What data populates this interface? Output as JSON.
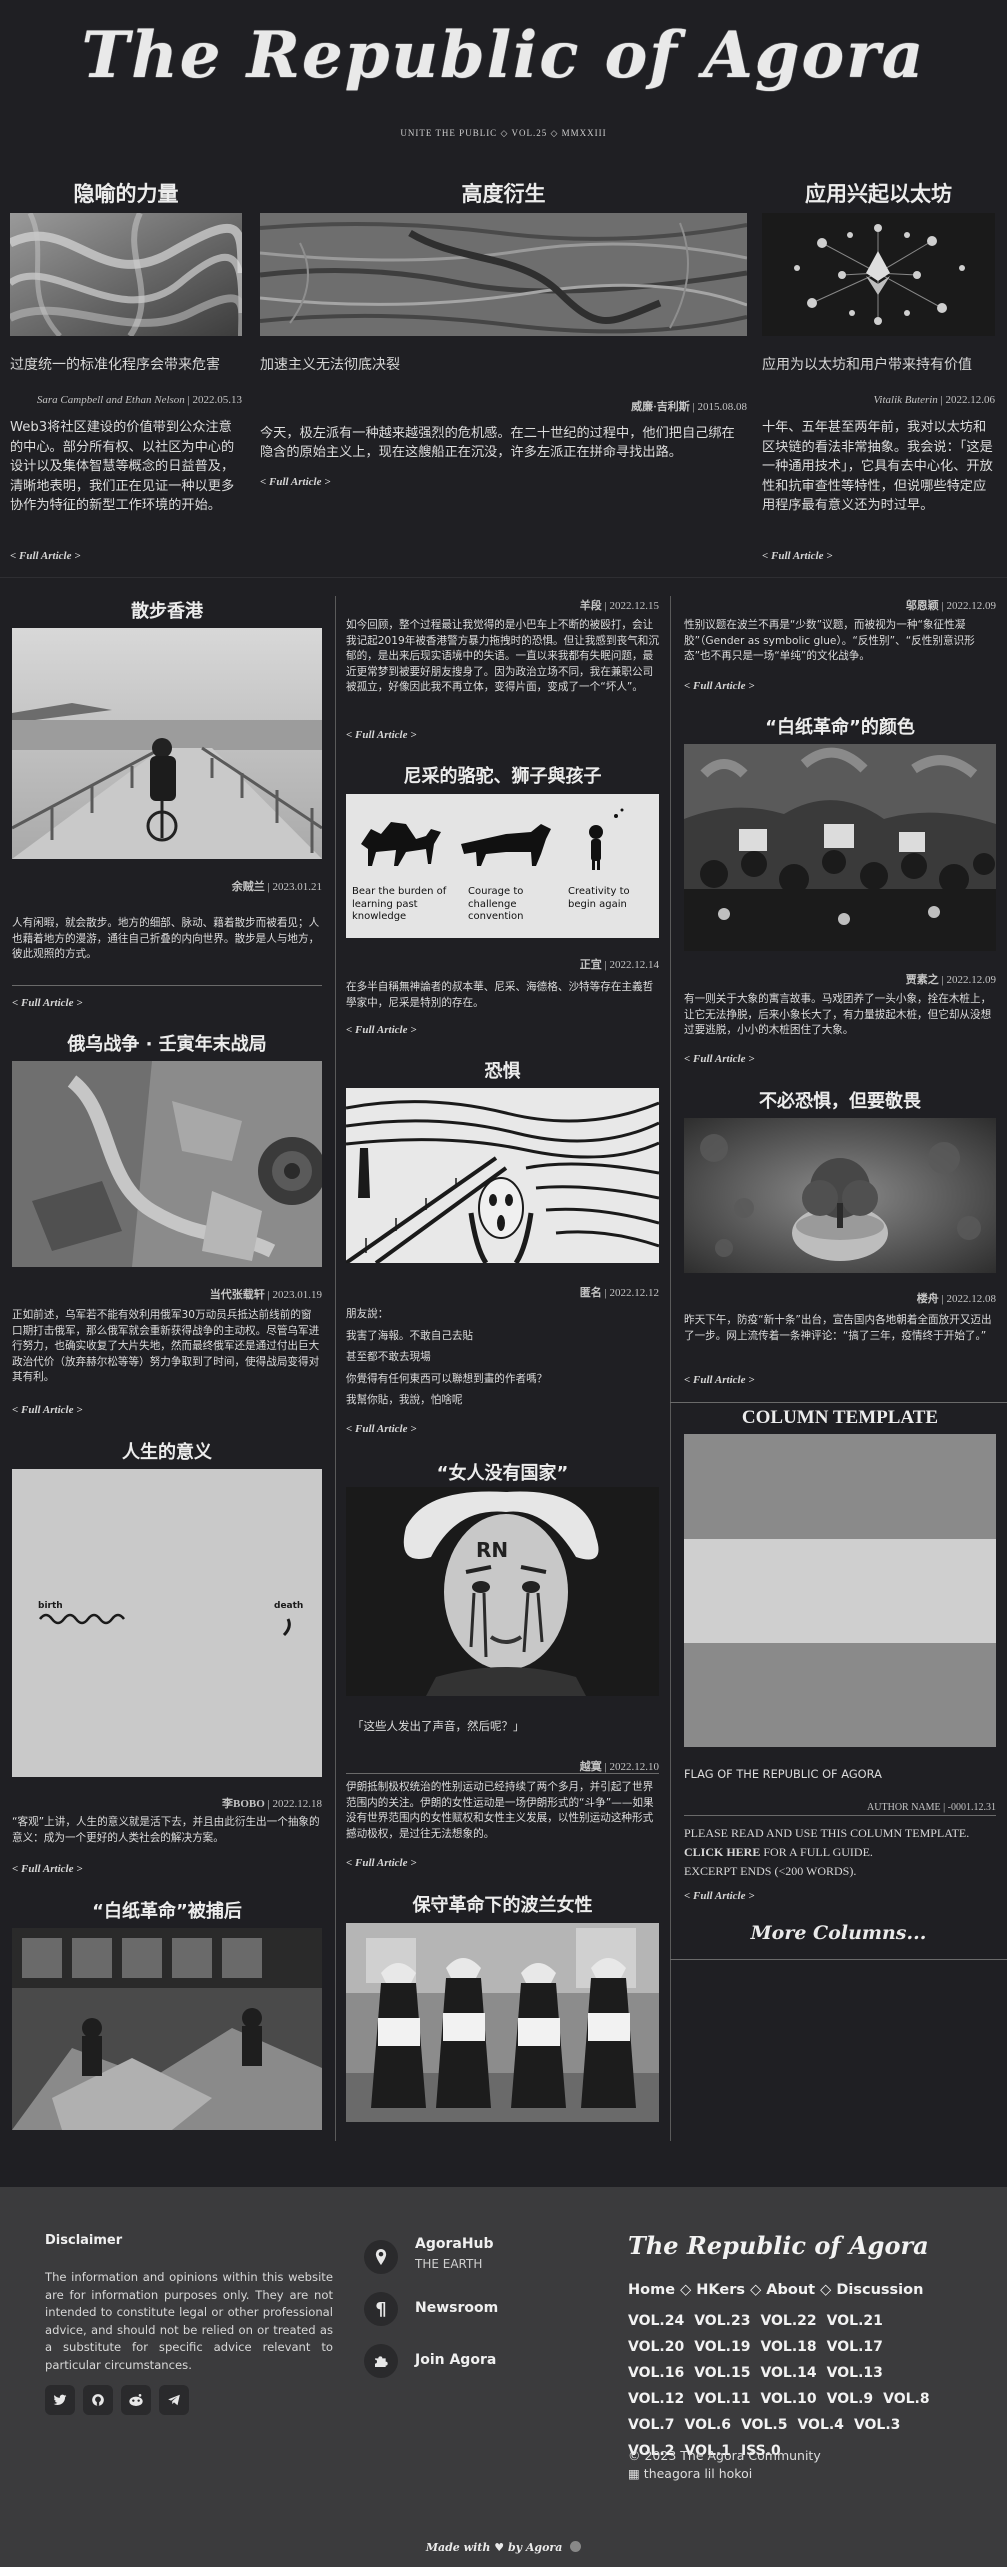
{
  "site": {
    "title": "The Republic of Agora",
    "subtitle": "UNITE THE PUBLIC ◇ VOL.25 ◇ MMXXIII"
  },
  "top": [
    {
      "heading": "隐喻的力量",
      "lead": "过度统一的标准化程序会带来危害",
      "byline_author": "Sara Campbell and Ethan Nelson",
      "byline_date": "| 2022.05.13",
      "body": "Web3将社区建设的价值带到公众注意的中心。部分所有权、以社区为中心的设计以及集体智慧等概念的日益普及，清晰地表明，我们正在见证一种以更多协作为特征的新型工作环境的开始。",
      "full": "< Full Article >",
      "image": "swirl-texture-image"
    },
    {
      "heading": "高度衍生",
      "lead": "加速主义无法彻底决裂",
      "byline_author": "威廉·吉利斯",
      "byline_date": "| 2015.08.08",
      "body": "今天，极左派有一种越来越强烈的危机感。在二十世纪的过程中，他们把自己绑在隐含的原始主义上，现在这艘船正在沉没，许多左派正在拼命寻找出路。",
      "full": "< Full Article >",
      "image": "bark-texture-image"
    },
    {
      "heading": "应用兴起以太坊",
      "lead": "应用为以太坊和用户带来持有价值",
      "byline_author": "Vitalik Buterin",
      "byline_date": "| 2022.12.06",
      "body": "十年、五年甚至两年前，我对以太坊和区块链的看法非常抽象。我会说：「这是一种通用技术」，它具有去中心化、开放性和抗审查性等特性，但说哪些特定应用程序最有意义还为时过早。",
      "full": "< Full Article >",
      "image": "ethereum-icons-image"
    }
  ],
  "col1": [
    {
      "heading": "散步香港",
      "byline_author": "余贼兰",
      "byline_date": "| 2023.01.21",
      "body": "人有闲暇，就会散步。地方的细部、脉动、藉着散步而被看见；人也藉着地方的漫游，通往自己折叠的内向世界。散步是人与地方，彼此观照的方式。",
      "full": "< Full Article >"
    },
    {
      "heading": "俄乌战争 · 壬寅年末战局",
      "byline_author": "当代张载轩",
      "byline_date": "| 2023.01.19",
      "body": "正如前述，乌军若不能有效利用俄军30万动员兵抵达前线前的窗口期打击俄军，那么俄军就会重新获得战争的主动权。尽管乌军进行努力，也确实收复了大片失地，然而最终俄军还是通过付出巨大政治代价（放弃赫尔松等等）努力争取到了时间，使得战局变得对其有利。",
      "full": "< Full Article >"
    },
    {
      "heading": "人生的意义",
      "birth": "birth",
      "death": "death",
      "byline_author": "李BOBO",
      "byline_date": "| 2022.12.18",
      "body": "“客观”上讲，人生的意义就是活下去，并且由此衍生出一个抽象的意义：成为一个更好的人类社会的解决方案。",
      "full": "< Full Article >"
    },
    {
      "heading": "“白纸革命”被捕后"
    }
  ],
  "col2": [
    {
      "byline_author": "羊段",
      "byline_date": "| 2022.12.15",
      "body": "如今回顾，整个过程最让我觉得的是小巴车上不断的被殴打，会让我记起2019年被香港警方暴力拖拽时的恐惧。但让我感到丧气和沉郁的，是出来后现实语境中的失语。一直以来我都有失眠问题，最近更常梦到被要好朋友搜身了。因为政治立场不同，我在兼职公司被孤立，好像因此我不再立体，变得片面，变成了一个“坏人”。",
      "full": "< Full Article >"
    },
    {
      "heading": "尼采的骆驼、狮子與孩子",
      "camel": "Bear the burden of learning past knowledge",
      "lion": "Courage to challenge convention",
      "child": "Creativity to begin again",
      "byline_author": "正宜",
      "byline_date": "| 2022.12.14",
      "body": "在多半自稱無神論者的叔本華、尼采、海德格、沙特等存在主義哲學家中，尼采是特別的存在。",
      "full": "< Full Article >"
    },
    {
      "heading": "恐惧",
      "byline_author": "匿名",
      "byline_date": "| 2022.12.12",
      "lines": [
        "朋友說：",
        "我害了海報。不敢自己去貼",
        "甚至都不敢去現場",
        "你覺得有任何東西可以聯想到畫的作者嗎？",
        "我幫你貼，我說，怕啥呢"
      ],
      "full": "< Full Article >"
    },
    {
      "heading": "“女人没有国家”",
      "quote": "「这些人发出了声音，然后呢？」",
      "byline_author": "越寞",
      "byline_date": "| 2022.12.10",
      "body": "伊朗抵制极权统治的性别运动已经持续了两个多月，并引起了世界范围内的关注。伊朗的女性运动是一场伊朗形式的“斗争”——如果没有世界范围内的女性赋权和女性主义发展，以性别运动这种形式撼动极权，是过往无法想象的。",
      "full": "< Full Article >"
    },
    {
      "heading": "保守革命下的波兰女性"
    }
  ],
  "col3": [
    {
      "byline_author": "邬恩颖",
      "byline_date": "| 2022.12.09",
      "body": "性别议题在波兰不再是“少数”议题，而被视为一种“象征性凝胶”（Gender as symbolic glue）。“反性别”、“反性别意识形态”也不再只是一场“单纯”的文化战争。",
      "full": "< Full Article >"
    },
    {
      "heading": "“白纸革命”的颜色",
      "byline_author": "贾素之",
      "byline_date": "| 2022.12.09",
      "body": "有一则关于大象的寓言故事。马戏团养了一头小象，拴在木桩上，让它无法挣脱，后来小象长大了，有力量拔起木桩，但它却从没想过要逃脱，小小的木桩困住了大象。",
      "full": "< Full Article >"
    },
    {
      "heading": "不必恐惧，但要敬畏",
      "byline_author": "楼舟",
      "byline_date": "| 2022.12.08",
      "body": "昨天下午，防疫“新十条”出台，宣告国内各地朝着全面放开又迈出了一步。网上流传着一条神评论：“搞了三年，疫情终于开始了。”",
      "full": "< Full Article >"
    },
    {
      "heading": "COLUMN TEMPLATE",
      "lead": "FLAG OF THE REPUBLIC OF AGORA",
      "byline_author": "AUTHOR NAME",
      "byline_date": "| -0001.12.31",
      "body1": "PLEASE READ AND USE THIS COLUMN TEMPLATE.",
      "click": "CLICK HERE",
      "body2": "FOR A FULL GUIDE.",
      "body3": "EXCERPT ENDS (<200 WORDS).",
      "full": "< Full Article >",
      "flag_colors": [
        "#8a8a8a",
        "#cfcfcf",
        "#8a8a8a"
      ]
    }
  ],
  "more_columns": "More Columns...",
  "footer": {
    "disclaimer_title": "Disclaimer",
    "disclaimer_text": "The information and opinions within this website are for information purposes only. They are not intended to constitute legal or other professional advice, and should not be relied on or treated as a substitute for specific advice relevant to particular circumstances.",
    "social": [
      "twitter-icon",
      "github-icon",
      "reddit-icon",
      "telegram-icon"
    ],
    "links": [
      {
        "label": "AgoraHub",
        "sub": "THE EARTH",
        "icon": "location-pin-icon"
      },
      {
        "label": "Newsroom",
        "sub": "",
        "icon": "pilcrow-icon"
      },
      {
        "label": "Join Agora",
        "sub": "",
        "icon": "puzzle-icon"
      }
    ],
    "brand": "The Republic of Agora",
    "nav": [
      "Home",
      "HKers",
      "About",
      "Discussion"
    ],
    "nav_sep": " ◇ ",
    "volumes": [
      "VOL.24",
      "VOL.23",
      "VOL.22",
      "VOL.21",
      "VOL.20",
      "VOL.19",
      "VOL.18",
      "VOL.17",
      "VOL.16",
      "VOL.15",
      "VOL.14",
      "VOL.13",
      "VOL.12",
      "VOL.11",
      "VOL.10",
      "VOL.9",
      "VOL.8",
      "VOL.7",
      "VOL.6",
      "VOL.5",
      "VOL.4",
      "VOL.3",
      "VOL.2",
      "VOL.1",
      "ISS.0"
    ],
    "copyright": "© 2023 The Agora Community",
    "author": "theagora lil hokoi",
    "made_with": "Made with",
    "by_agora": "by Agora"
  }
}
